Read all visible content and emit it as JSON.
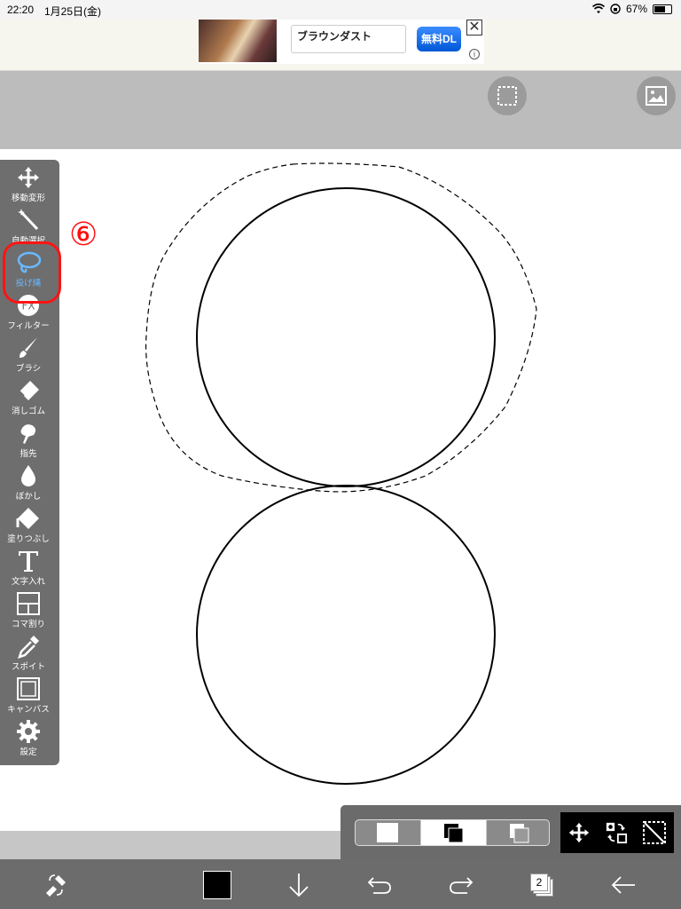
{
  "status_bar": {
    "time": "22:20",
    "date": "1月25日(金)",
    "battery_percent": "67%",
    "battery_level": 0.67
  },
  "ad": {
    "title": "ブラウンダスト",
    "cta": "無料DL",
    "close_icon": "close-icon",
    "info_icon": "info-icon"
  },
  "top_toolbar": {
    "buttons": [
      "selection-icon",
      "image-icon"
    ]
  },
  "tools": [
    {
      "label": "移動変形",
      "icon": "move-icon"
    },
    {
      "label": "自動選択",
      "icon": "magic-wand-icon"
    },
    {
      "label": "投げ縄",
      "icon": "lasso-icon",
      "active": true
    },
    {
      "label": "フィルター",
      "icon": "fx-icon"
    },
    {
      "label": "ブラシ",
      "icon": "brush-icon"
    },
    {
      "label": "消しゴム",
      "icon": "eraser-icon"
    },
    {
      "label": "指先",
      "icon": "finger-icon"
    },
    {
      "label": "ぼかし",
      "icon": "blur-drop-icon"
    },
    {
      "label": "塗りつぶし",
      "icon": "bucket-icon"
    },
    {
      "label": "文字入れ",
      "icon": "text-icon"
    },
    {
      "label": "コマ割り",
      "icon": "frame-divider-icon"
    },
    {
      "label": "スポイト",
      "icon": "eyedropper-icon"
    },
    {
      "label": "キャンバス",
      "icon": "canvas-icon"
    },
    {
      "label": "設定",
      "icon": "gear-icon"
    }
  ],
  "annotation": {
    "number": "⑥",
    "color": "#ff1414"
  },
  "selection_mode": {
    "options": [
      "new-selection-icon",
      "add-selection-icon",
      "subtract-selection-icon"
    ],
    "active": "add-selection-icon"
  },
  "selection_actions": [
    "move-selection-icon",
    "invert-selection-icon",
    "clear-selection-icon"
  ],
  "bottom_bar": {
    "current_color": "#000000",
    "layer_count": "2",
    "icons": [
      "swap-tool-icon",
      "color-swatch",
      "download-icon",
      "undo-icon",
      "redo-icon",
      "layers-icon",
      "back-icon"
    ]
  },
  "colors": {
    "palette_bg": "#6e6e6e",
    "active_tool": "#6ab8ff",
    "toolbar_bg": "#bcbcbc"
  }
}
